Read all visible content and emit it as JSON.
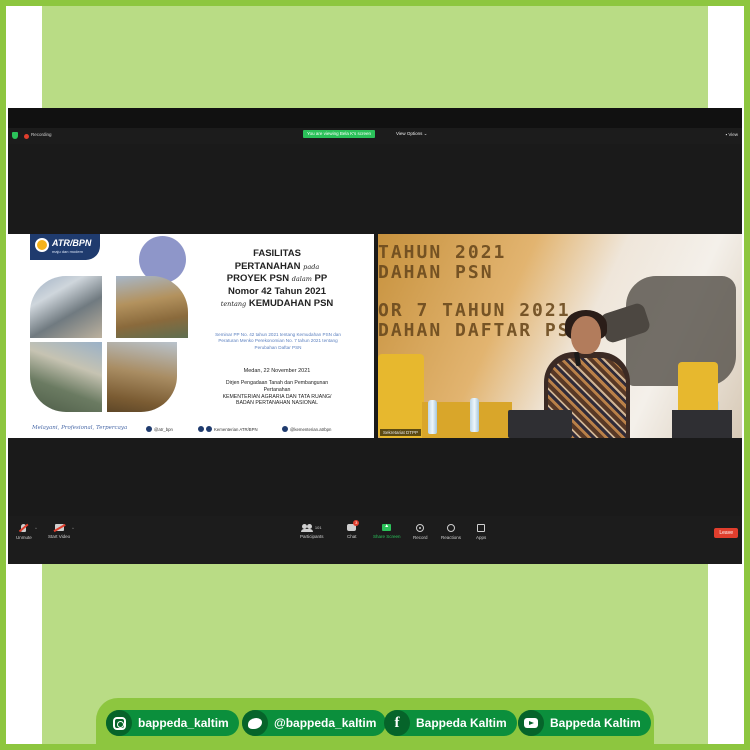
{
  "zoom": {
    "recording_label": "Recording",
    "viewing_banner": "You are viewing Bela K's screen",
    "view_options": "View Options ⌄",
    "view_button": "▪ View",
    "leave_label": "Leave"
  },
  "slide": {
    "logo_text": "ATR/BPN",
    "logo_sub": "maju dan modern",
    "title_l1": "FASILITAS",
    "title_l2a": "PERTANAHAN",
    "title_l2b": "pada",
    "title_l3a": "PROYEK PSN",
    "title_l3b": "dalam",
    "title_l3c": "PP",
    "title_l4": "Nomor 42 Tahun 2021",
    "title_l5a": "tentang",
    "title_l5b": "KEMUDAHAN PSN",
    "subtitle": "Seminar PP No. 42 tahun 2021 tentang Kemudahan PSN dan Peraturan Menko Perekonomian No. 7 tahun 2021 tentang Perubahan Daftar PSN",
    "date": "Medan, 22 November 2021",
    "org_l1": "Dirjen Pengadaan Tanah dan Pembangunan",
    "org_l2": "Pertanahan",
    "org_l3": "KEMENTERIAN AGRARIA DAN TATA RUANG/",
    "org_l4": "BADAN PERTANAHAN NASIONAL",
    "tagline": "Melayani, Profesional, Terpercaya",
    "social_1": "@atr_bpn",
    "social_2": "Kementerian ATR/BPN",
    "social_3": "@kementerian.atrbpn"
  },
  "speaker": {
    "banner_1": "TAHUN 2021",
    "banner_2": "DAHAN PSN",
    "banner_3": "OR 7 TAHUN 2021",
    "banner_4": "DAHAN DAFTAR PS",
    "name_tag": "Sekretariat DTPP"
  },
  "toolbar": {
    "unmute": "Unmute",
    "start_video": "Start Video",
    "participants": "Participants",
    "participants_count": "101",
    "chat": "Chat",
    "chat_badge": "3",
    "share_screen": "Share Screen",
    "record": "Record",
    "reactions": "Reactions",
    "apps": "Apps"
  },
  "social": {
    "instagram": "bappeda_kaltim",
    "twitter": "@bappeda_kaltim",
    "facebook": "Bappeda Kaltim",
    "youtube": "Bappeda Kaltim"
  },
  "colors": {
    "frame_green": "#8dc63f",
    "panel_green": "#b9dc85",
    "pill_green": "#0b8f3c",
    "zoom_green": "#2bc25a",
    "leave_red": "#e03e2d"
  }
}
